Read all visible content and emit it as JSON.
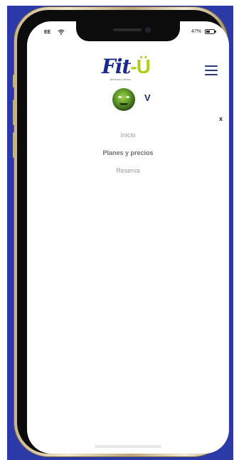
{
  "status_bar": {
    "carrier": "EE",
    "battery_text": "47%",
    "battery_level": 0.47,
    "icons": [
      "wifi-icon",
      "battery-icon"
    ]
  },
  "header": {
    "logo": {
      "main": "Fit",
      "accent": "-Ü",
      "tagline": "Bienestar y fitness"
    },
    "menu_icon": "hamburger-icon"
  },
  "user": {
    "initial": "V"
  },
  "nav": {
    "close_label": "x",
    "items": [
      {
        "label": "Inicio",
        "active": false
      },
      {
        "label": "Planes y precios",
        "active": true
      },
      {
        "label": "Reserva",
        "active": false
      }
    ]
  },
  "colors": {
    "background": "#2b3aa6",
    "brand_blue": "#1a2a8a",
    "brand_green": "#b5cc1c",
    "menu_text": "#9a9a9a"
  }
}
